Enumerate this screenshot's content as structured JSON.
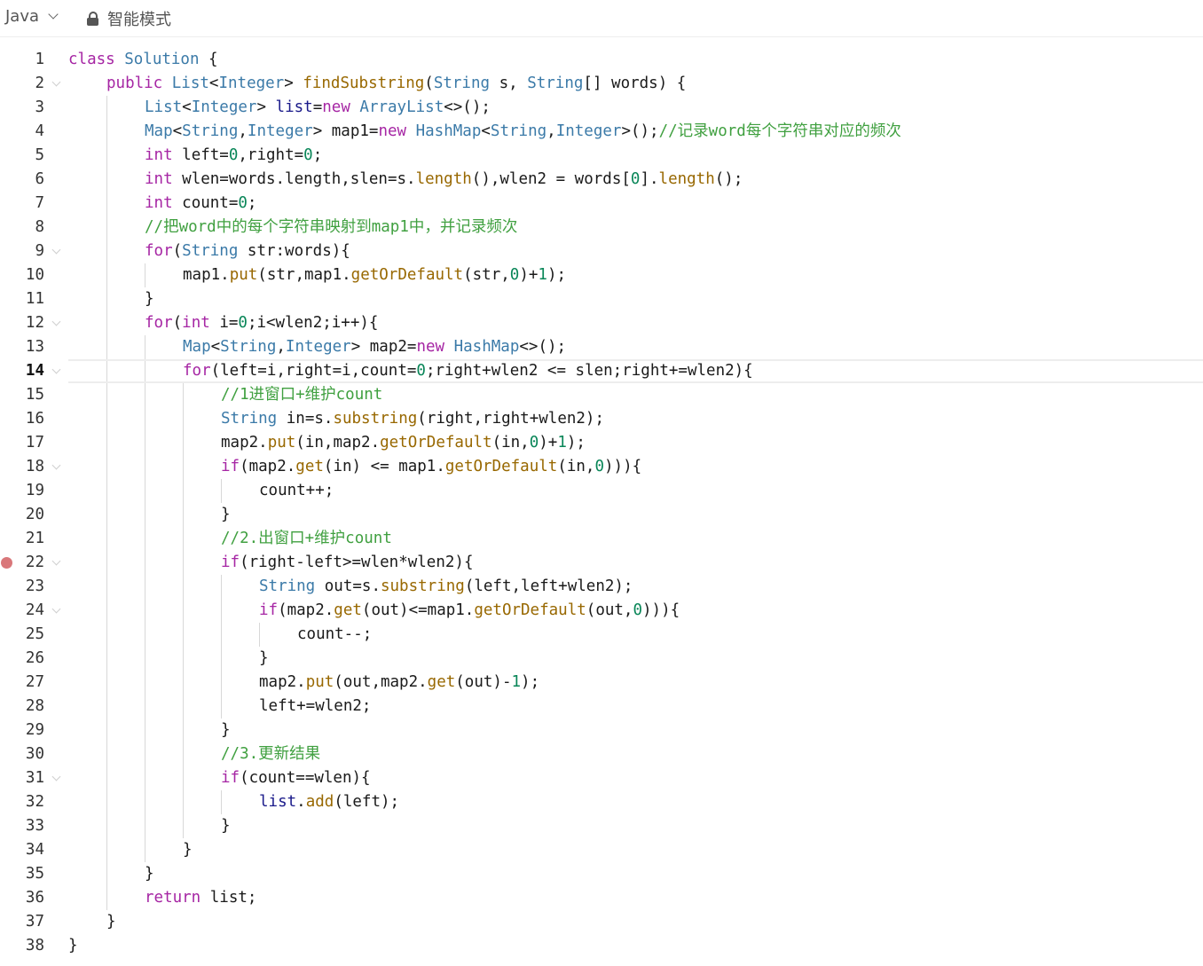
{
  "toolbar": {
    "language": "Java",
    "mode": "智能模式"
  },
  "editor": {
    "current_line": 14,
    "breakpoint_line": 22,
    "lines": [
      {
        "n": "1",
        "indent": 0,
        "fold": false,
        "segs": [
          [
            "kw",
            "class "
          ],
          [
            "ty",
            "Solution"
          ],
          [
            "pl",
            " {"
          ]
        ]
      },
      {
        "n": "2",
        "indent": 1,
        "fold": true,
        "segs": [
          [
            "kw",
            "public "
          ],
          [
            "ty",
            "List"
          ],
          [
            "pl",
            "<"
          ],
          [
            "ty",
            "Integer"
          ],
          [
            "pl",
            "> "
          ],
          [
            "fn",
            "findSubstring"
          ],
          [
            "pl",
            "("
          ],
          [
            "ty",
            "String"
          ],
          [
            "pl",
            " s, "
          ],
          [
            "ty",
            "String"
          ],
          [
            "pl",
            "[] words) {"
          ]
        ]
      },
      {
        "n": "3",
        "indent": 2,
        "fold": false,
        "segs": [
          [
            "ty",
            "List"
          ],
          [
            "pl",
            "<"
          ],
          [
            "ty",
            "Integer"
          ],
          [
            "pl",
            "> "
          ],
          [
            "va",
            "list"
          ],
          [
            "pl",
            "="
          ],
          [
            "kw",
            "new "
          ],
          [
            "ty",
            "ArrayList"
          ],
          [
            "pl",
            "<>();"
          ]
        ]
      },
      {
        "n": "4",
        "indent": 2,
        "fold": false,
        "segs": [
          [
            "ty",
            "Map"
          ],
          [
            "pl",
            "<"
          ],
          [
            "ty",
            "String"
          ],
          [
            "pl",
            ","
          ],
          [
            "ty",
            "Integer"
          ],
          [
            "pl",
            "> map1="
          ],
          [
            "kw",
            "new "
          ],
          [
            "ty",
            "HashMap"
          ],
          [
            "pl",
            "<"
          ],
          [
            "ty",
            "String"
          ],
          [
            "pl",
            ","
          ],
          [
            "ty",
            "Integer"
          ],
          [
            "pl",
            ">();"
          ],
          [
            "cm",
            "//记录word每个字符串对应的频次"
          ]
        ]
      },
      {
        "n": "5",
        "indent": 2,
        "fold": false,
        "segs": [
          [
            "kw",
            "int "
          ],
          [
            "pl",
            "left="
          ],
          [
            "num",
            "0"
          ],
          [
            "pl",
            ",right="
          ],
          [
            "num",
            "0"
          ],
          [
            "pl",
            ";"
          ]
        ]
      },
      {
        "n": "6",
        "indent": 2,
        "fold": false,
        "segs": [
          [
            "kw",
            "int "
          ],
          [
            "pl",
            "wlen=words.length,slen=s."
          ],
          [
            "fn",
            "length"
          ],
          [
            "pl",
            "(),wlen2 = words["
          ],
          [
            "num",
            "0"
          ],
          [
            "pl",
            "]."
          ],
          [
            "fn",
            "length"
          ],
          [
            "pl",
            "();"
          ]
        ]
      },
      {
        "n": "7",
        "indent": 2,
        "fold": false,
        "segs": [
          [
            "kw",
            "int "
          ],
          [
            "pl",
            "count="
          ],
          [
            "num",
            "0"
          ],
          [
            "pl",
            ";"
          ]
        ]
      },
      {
        "n": "8",
        "indent": 2,
        "fold": false,
        "segs": [
          [
            "cm",
            "//把word中的每个字符串映射到map1中，并记录频次"
          ]
        ]
      },
      {
        "n": "9",
        "indent": 2,
        "fold": true,
        "segs": [
          [
            "kw",
            "for"
          ],
          [
            "pl",
            "("
          ],
          [
            "ty",
            "String"
          ],
          [
            "pl",
            " str:words){"
          ]
        ]
      },
      {
        "n": "10",
        "indent": 3,
        "fold": false,
        "segs": [
          [
            "pl",
            "map1."
          ],
          [
            "fn",
            "put"
          ],
          [
            "pl",
            "(str,map1."
          ],
          [
            "fn",
            "getOrDefault"
          ],
          [
            "pl",
            "(str,"
          ],
          [
            "num",
            "0"
          ],
          [
            "pl",
            ")+"
          ],
          [
            "num",
            "1"
          ],
          [
            "pl",
            ");"
          ]
        ]
      },
      {
        "n": "11",
        "indent": 2,
        "fold": false,
        "segs": [
          [
            "pl",
            "}"
          ]
        ]
      },
      {
        "n": "12",
        "indent": 2,
        "fold": true,
        "segs": [
          [
            "kw",
            "for"
          ],
          [
            "pl",
            "("
          ],
          [
            "kw",
            "int "
          ],
          [
            "pl",
            "i="
          ],
          [
            "num",
            "0"
          ],
          [
            "pl",
            ";i<wlen2;i++){"
          ]
        ]
      },
      {
        "n": "13",
        "indent": 3,
        "fold": false,
        "segs": [
          [
            "ty",
            "Map"
          ],
          [
            "pl",
            "<"
          ],
          [
            "ty",
            "String"
          ],
          [
            "pl",
            ","
          ],
          [
            "ty",
            "Integer"
          ],
          [
            "pl",
            "> map2="
          ],
          [
            "kw",
            "new "
          ],
          [
            "ty",
            "HashMap"
          ],
          [
            "pl",
            "<>();"
          ]
        ]
      },
      {
        "n": "14",
        "indent": 3,
        "fold": true,
        "segs": [
          [
            "kw",
            "for"
          ],
          [
            "pl",
            "(left=i,right=i,count="
          ],
          [
            "num",
            "0"
          ],
          [
            "pl",
            ";right+wlen2 <= slen;right+=wlen2){"
          ]
        ]
      },
      {
        "n": "15",
        "indent": 4,
        "fold": false,
        "segs": [
          [
            "cm",
            "//1进窗口+维护count"
          ]
        ]
      },
      {
        "n": "16",
        "indent": 4,
        "fold": false,
        "segs": [
          [
            "ty",
            "String "
          ],
          [
            "pl",
            "in=s."
          ],
          [
            "fn",
            "substring"
          ],
          [
            "pl",
            "(right,right+wlen2);"
          ]
        ]
      },
      {
        "n": "17",
        "indent": 4,
        "fold": false,
        "segs": [
          [
            "pl",
            "map2."
          ],
          [
            "fn",
            "put"
          ],
          [
            "pl",
            "(in,map2."
          ],
          [
            "fn",
            "getOrDefault"
          ],
          [
            "pl",
            "(in,"
          ],
          [
            "num",
            "0"
          ],
          [
            "pl",
            ")+"
          ],
          [
            "num",
            "1"
          ],
          [
            "pl",
            ");"
          ]
        ]
      },
      {
        "n": "18",
        "indent": 4,
        "fold": true,
        "segs": [
          [
            "kw",
            "if"
          ],
          [
            "pl",
            "(map2."
          ],
          [
            "fn",
            "get"
          ],
          [
            "pl",
            "(in) <= map1."
          ],
          [
            "fn",
            "getOrDefault"
          ],
          [
            "pl",
            "(in,"
          ],
          [
            "num",
            "0"
          ],
          [
            "pl",
            "))){"
          ]
        ]
      },
      {
        "n": "19",
        "indent": 5,
        "fold": false,
        "segs": [
          [
            "pl",
            "count++;"
          ]
        ]
      },
      {
        "n": "20",
        "indent": 4,
        "fold": false,
        "segs": [
          [
            "pl",
            "}"
          ]
        ]
      },
      {
        "n": "21",
        "indent": 4,
        "fold": false,
        "segs": [
          [
            "cm",
            "//2.出窗口+维护count"
          ]
        ]
      },
      {
        "n": "22",
        "indent": 4,
        "fold": true,
        "segs": [
          [
            "kw",
            "if"
          ],
          [
            "pl",
            "(right-left>=wlen*wlen2){"
          ]
        ]
      },
      {
        "n": "23",
        "indent": 5,
        "fold": false,
        "segs": [
          [
            "ty",
            "String "
          ],
          [
            "pl",
            "out=s."
          ],
          [
            "fn",
            "substring"
          ],
          [
            "pl",
            "(left,left+wlen2);"
          ]
        ]
      },
      {
        "n": "24",
        "indent": 5,
        "fold": true,
        "segs": [
          [
            "kw",
            "if"
          ],
          [
            "pl",
            "(map2."
          ],
          [
            "fn",
            "get"
          ],
          [
            "pl",
            "(out)<=map1."
          ],
          [
            "fn",
            "getOrDefault"
          ],
          [
            "pl",
            "(out,"
          ],
          [
            "num",
            "0"
          ],
          [
            "pl",
            "))){"
          ]
        ]
      },
      {
        "n": "25",
        "indent": 6,
        "fold": false,
        "segs": [
          [
            "pl",
            "count--;"
          ]
        ]
      },
      {
        "n": "26",
        "indent": 5,
        "fold": false,
        "segs": [
          [
            "pl",
            "}"
          ]
        ]
      },
      {
        "n": "27",
        "indent": 5,
        "fold": false,
        "segs": [
          [
            "pl",
            "map2."
          ],
          [
            "fn",
            "put"
          ],
          [
            "pl",
            "(out,map2."
          ],
          [
            "fn",
            "get"
          ],
          [
            "pl",
            "(out)-"
          ],
          [
            "num",
            "1"
          ],
          [
            "pl",
            ");"
          ]
        ]
      },
      {
        "n": "28",
        "indent": 5,
        "fold": false,
        "segs": [
          [
            "pl",
            "left+=wlen2;"
          ]
        ]
      },
      {
        "n": "29",
        "indent": 4,
        "fold": false,
        "segs": [
          [
            "pl",
            "}"
          ]
        ]
      },
      {
        "n": "30",
        "indent": 4,
        "fold": false,
        "segs": [
          [
            "cm",
            "//3.更新结果"
          ]
        ]
      },
      {
        "n": "31",
        "indent": 4,
        "fold": true,
        "segs": [
          [
            "kw",
            "if"
          ],
          [
            "pl",
            "(count==wlen){"
          ]
        ]
      },
      {
        "n": "32",
        "indent": 5,
        "fold": false,
        "segs": [
          [
            "va",
            "list"
          ],
          [
            "pl",
            "."
          ],
          [
            "fn",
            "add"
          ],
          [
            "pl",
            "(left);"
          ]
        ]
      },
      {
        "n": "33",
        "indent": 4,
        "fold": false,
        "segs": [
          [
            "pl",
            "}"
          ]
        ]
      },
      {
        "n": "34",
        "indent": 3,
        "fold": false,
        "segs": [
          [
            "pl",
            "}"
          ]
        ]
      },
      {
        "n": "35",
        "indent": 2,
        "fold": false,
        "segs": [
          [
            "pl",
            "}"
          ]
        ]
      },
      {
        "n": "36",
        "indent": 2,
        "fold": false,
        "segs": [
          [
            "kw",
            "return "
          ],
          [
            "pl",
            "list;"
          ]
        ]
      },
      {
        "n": "37",
        "indent": 1,
        "fold": false,
        "segs": [
          [
            "pl",
            "}"
          ]
        ]
      },
      {
        "n": "38",
        "indent": 0,
        "fold": false,
        "segs": [
          [
            "pl",
            "}"
          ]
        ]
      }
    ]
  }
}
